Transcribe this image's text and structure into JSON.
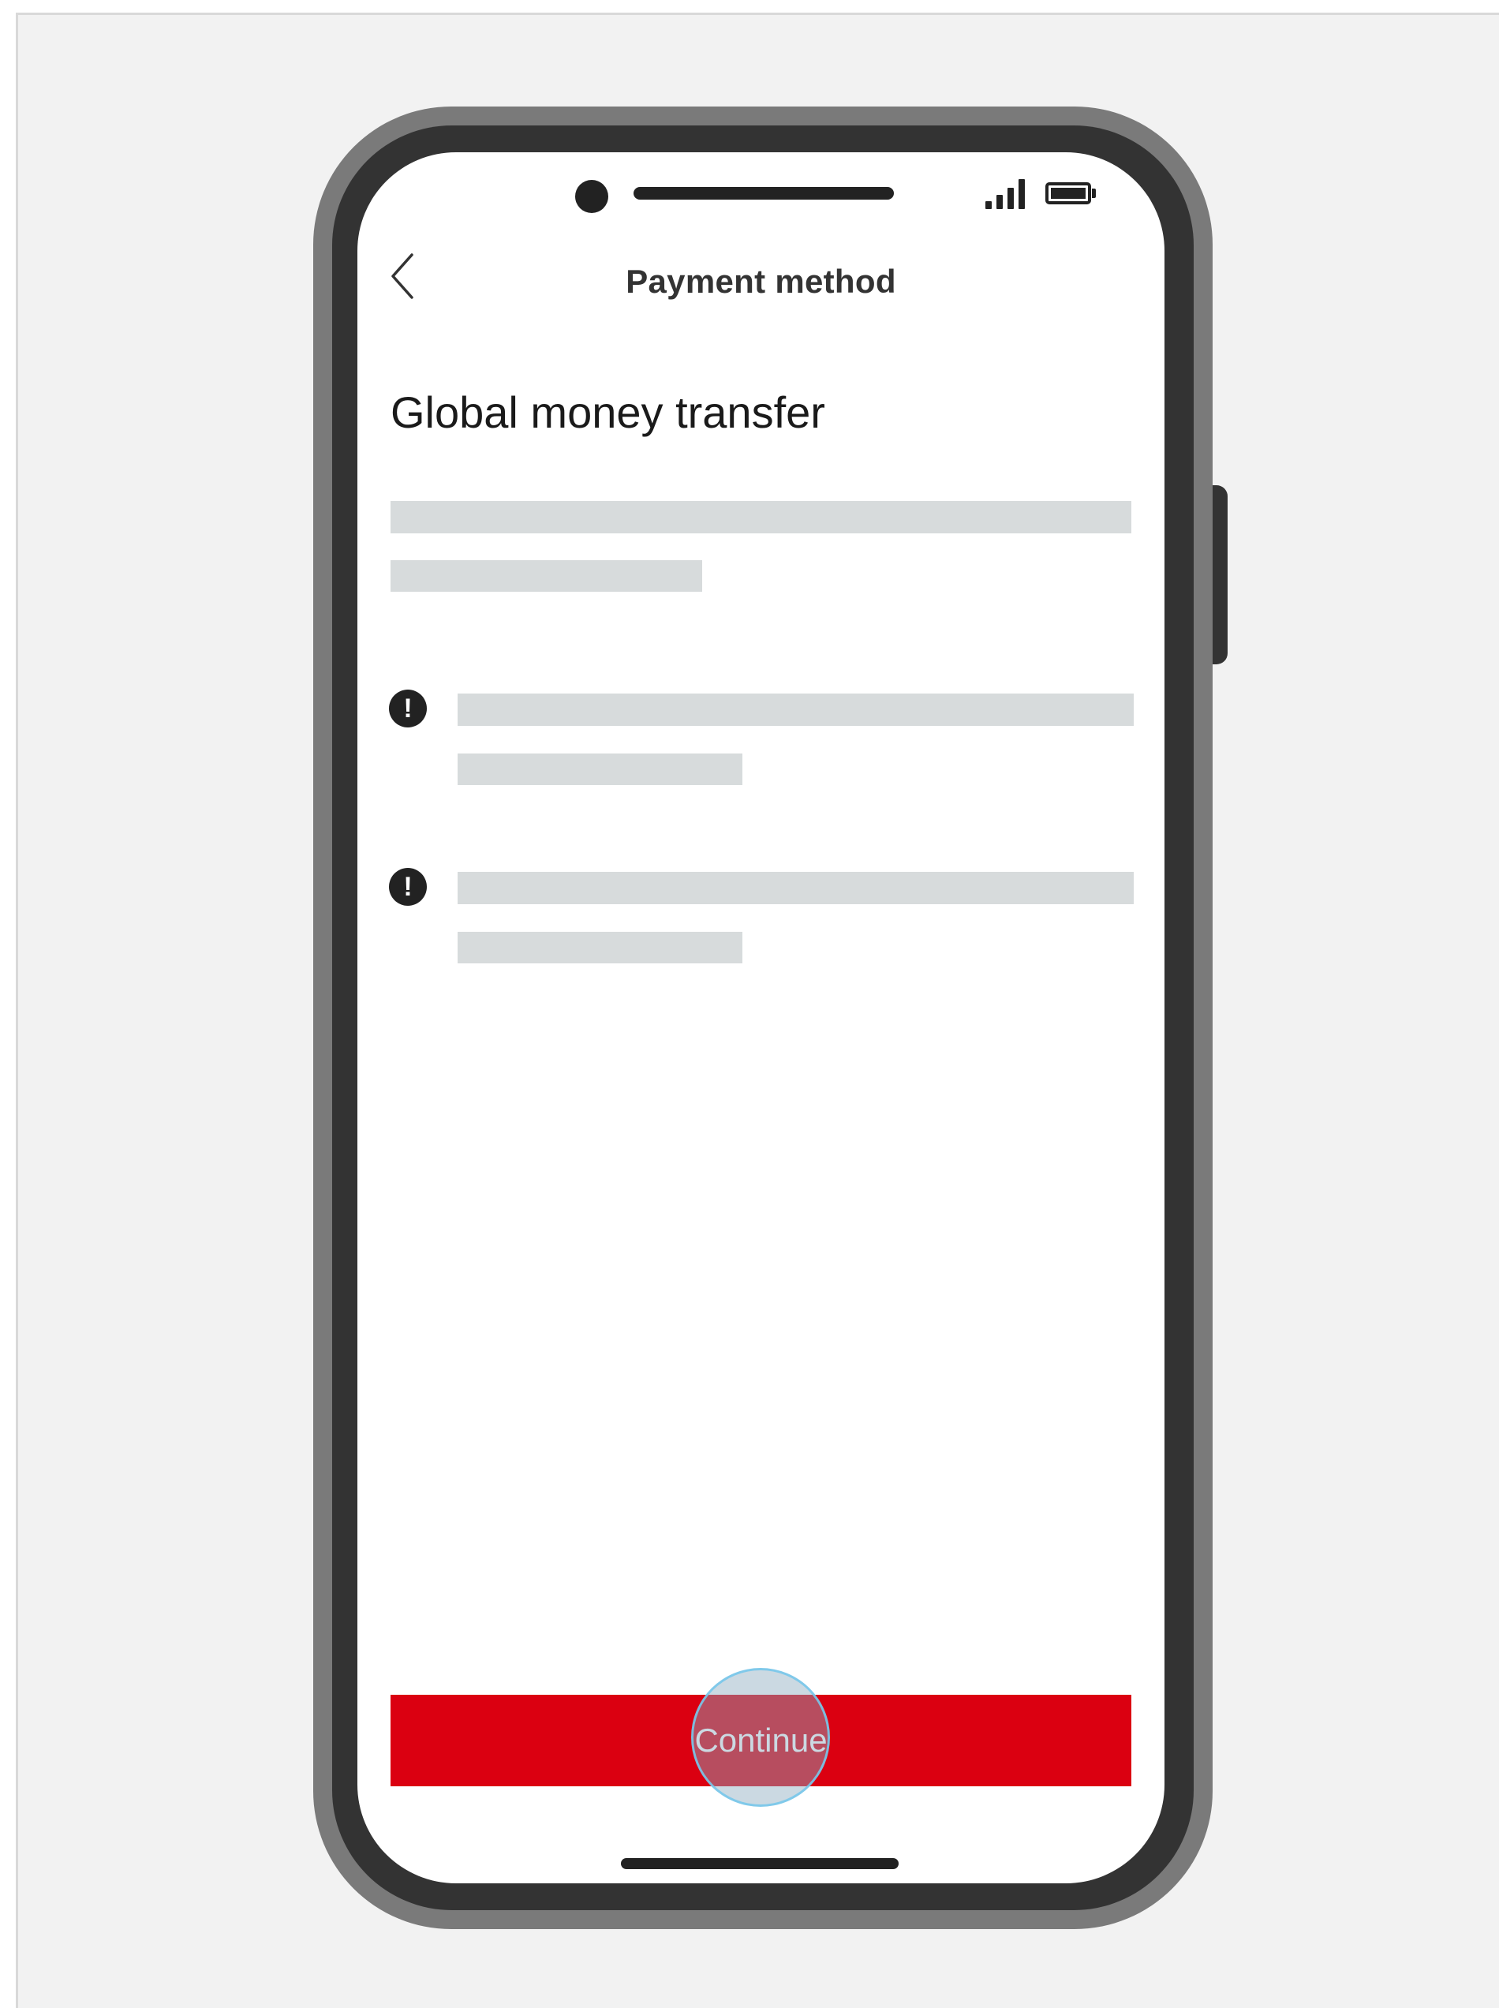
{
  "header": {
    "title": "Payment method",
    "back_icon": "chevron-left-icon"
  },
  "main": {
    "title": "Global money transfer",
    "notices": [
      {
        "icon": "exclamation-circle-icon",
        "glyph": "!"
      },
      {
        "icon": "exclamation-circle-icon",
        "glyph": "!"
      }
    ]
  },
  "footer": {
    "continue_label": "Continue"
  },
  "colors": {
    "accent": "#db0011",
    "placeholder": "#d7dbdc",
    "frame": "#333333",
    "frame_outer": "#7a7a7a",
    "background": "#f2f2f2"
  }
}
